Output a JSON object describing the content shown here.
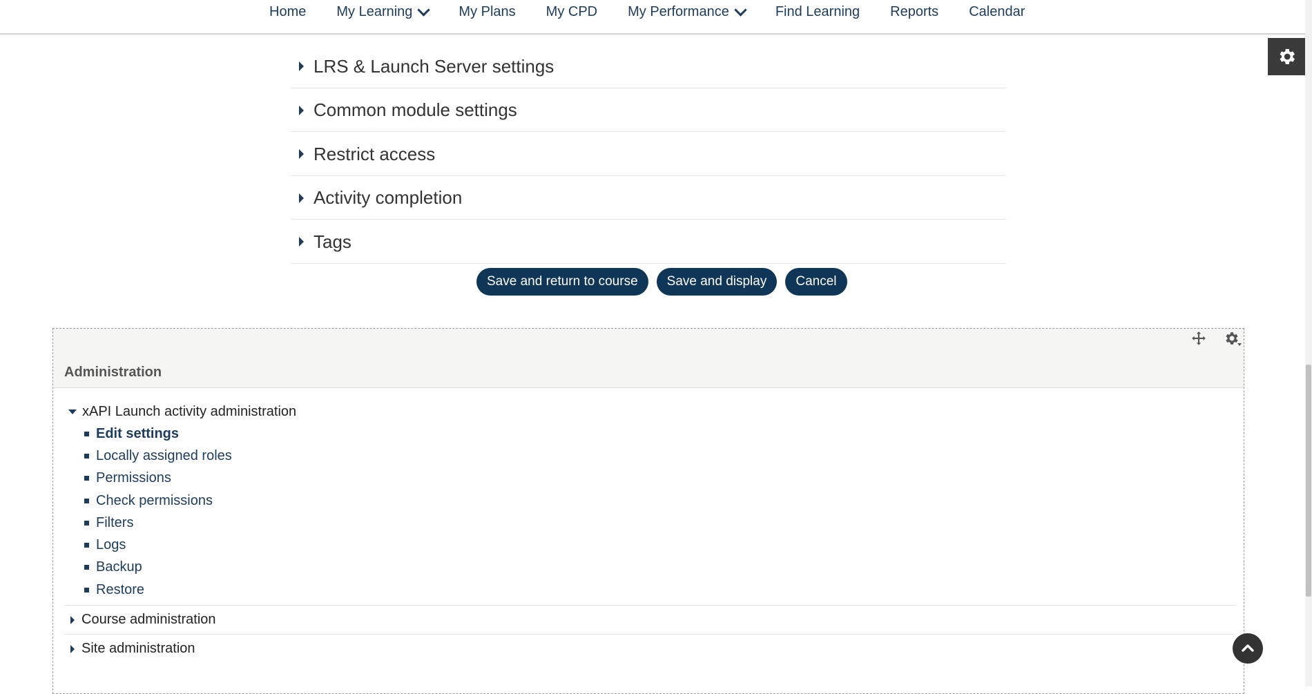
{
  "nav": {
    "items": [
      {
        "label": "Home",
        "dropdown": false
      },
      {
        "label": "My Learning",
        "dropdown": true
      },
      {
        "label": "My Plans",
        "dropdown": false
      },
      {
        "label": "My CPD",
        "dropdown": false
      },
      {
        "label": "My Performance",
        "dropdown": true
      },
      {
        "label": "Find Learning",
        "dropdown": false
      },
      {
        "label": "Reports",
        "dropdown": false
      },
      {
        "label": "Calendar",
        "dropdown": false
      }
    ]
  },
  "sections": [
    "LRS & Launch Server settings",
    "Common module settings",
    "Restrict access",
    "Activity completion",
    "Tags"
  ],
  "buttons": {
    "save_return": "Save and return to course",
    "save_display": "Save and display",
    "cancel": "Cancel"
  },
  "admin": {
    "title": "Administration",
    "expanded": {
      "label": "xAPI Launch activity administration",
      "children": [
        "Edit settings",
        "Locally assigned roles",
        "Permissions",
        "Check permissions",
        "Filters",
        "Logs",
        "Backup",
        "Restore"
      ]
    },
    "collapsed": [
      "Course administration",
      "Site administration"
    ]
  },
  "colors": {
    "accent": "#0f3557",
    "link": "#1d3c5c",
    "dark_button": "#3a3a3a"
  }
}
